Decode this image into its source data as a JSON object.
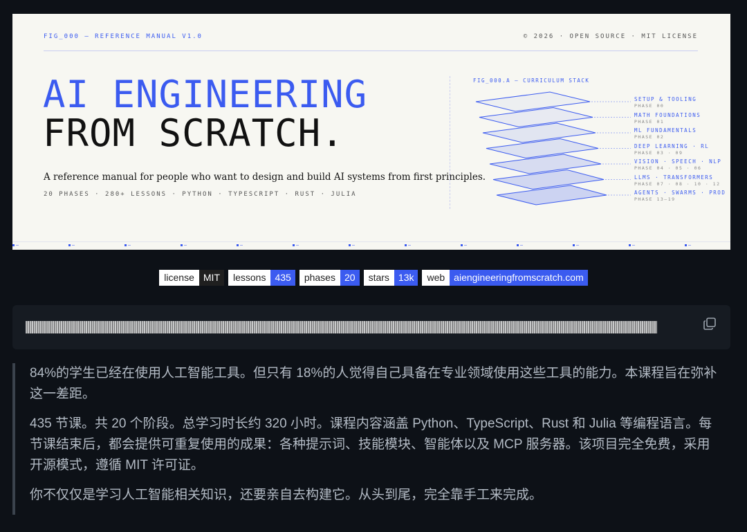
{
  "banner": {
    "fig_label": "FIG_000 — REFERENCE MANUAL V1.0",
    "copyright": "© 2026 · OPEN SOURCE · MIT LICENSE",
    "title_line1": "AI ENGINEERING",
    "title_line2": "FROM SCRATCH.",
    "subtitle": "A reference manual for people who want to design and build AI systems from first principles.",
    "meta": "20 PHASES · 280+ LESSONS · PYTHON · TYPESCRIPT · RUST · JULIA",
    "stack_title": "FIG_000.A — CURRICULUM STACK",
    "layers": [
      {
        "label": "SETUP & TOOLING",
        "phase": "PHASE 00"
      },
      {
        "label": "MATH FOUNDATIONS",
        "phase": "PHASE 01"
      },
      {
        "label": "ML FUNDAMENTALS",
        "phase": "PHASE 02"
      },
      {
        "label": "DEEP LEARNING · RL",
        "phase": "PHASE 03 · 09"
      },
      {
        "label": "VISION · SPEECH · NLP",
        "phase": "PHASE 04 · 05 · 06"
      },
      {
        "label": "LLMS · TRANSFORMERS",
        "phase": "PHASE 07 · 08 · 10 · 12"
      },
      {
        "label": "AGENTS · SWARMS · PROD",
        "phase": "PHASE 13–19"
      }
    ]
  },
  "badges": [
    {
      "key": "license",
      "value": "MIT",
      "color": "#1f1f1f"
    },
    {
      "key": "lessons",
      "value": "435",
      "color": "#3b5bf0"
    },
    {
      "key": "phases",
      "value": "20",
      "color": "#3b5bf0"
    },
    {
      "key": "stars",
      "value": "13k",
      "color": "#3b5bf0"
    },
    {
      "key": "web",
      "value": "aiengineeringfromscratch.com",
      "color": "#3b5bf0"
    }
  ],
  "quote": {
    "p1": "84%的学生已经在使用人工智能工具。但只有 18%的人觉得自己具备在专业领域使用这些工具的能力。本课程旨在弥补这一差距。",
    "p2": "435 节课。共 20 个阶段。总学习时长约 320 小时。课程内容涵盖 Python、TypeScript、Rust 和 Julia 等编程语言。每节课结束后，都会提供可重复使用的成果：各种提示词、技能模块、智能体以及 MCP 服务器。该项目完全免费，采用开源模式，遵循 MIT 许可证。",
    "p3": "你不仅仅是学习人工智能相关知识，还要亲自去构建它。从头到尾，完全靠手工来完成。"
  },
  "colors": {
    "accent": "#3b5bf0",
    "background": "#0d1117",
    "code_bg": "#161b22"
  },
  "icons": {
    "copy": "copy-icon"
  }
}
